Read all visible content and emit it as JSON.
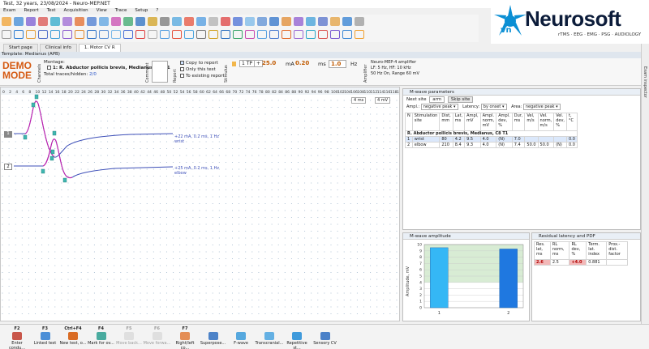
{
  "window": {
    "title": "Test, 32 years, 23/08/2024 - Neuro-MEP.NET"
  },
  "menu": [
    "Exam",
    "Report",
    "Test",
    "Acquisition",
    "View",
    "Trace",
    "Setup",
    "?"
  ],
  "logo": {
    "brand": "Neurosoft",
    "region": "vn",
    "tagline": "rTMS · EEG · EMG · PSG · AUDIOLOGY"
  },
  "tabs": [
    {
      "label": "Start page",
      "active": false
    },
    {
      "label": "Clinical info",
      "active": false
    },
    {
      "label": "1. Motor CV R",
      "active": true
    }
  ],
  "template": {
    "label": "Template: Medianus (APB)"
  },
  "controls": {
    "demo_line1": "DEMO",
    "demo_line2": "MODE",
    "channels_label": "Channels",
    "montage_label": "Montage:",
    "montage_value": "1: R. Abductor pollicis brevis, Medianus, C8 T1",
    "traces_label": "Total traces/hidden:",
    "traces_value": "2/0",
    "comment_label": "Comment",
    "report_label": "Report",
    "copy_to_report": "Copy to report",
    "only_this_test": "Only this test",
    "to_existing_report": "To existing report",
    "stimulus_label": "Stimulus",
    "tp_label": "1 TP",
    "current": "25.0",
    "current_unit": "mA",
    "duration": "0.20",
    "duration_unit": "ms",
    "frequency": "1.0",
    "frequency_unit": "Hz",
    "amplifier_label": "Amplifier",
    "amp_name": "Neuro-MEP-4 amplifier",
    "amp_lf": "LF: 5 Hz, HF: 10 kHz",
    "amp_notch": "50 Hz  On, Range 60 mV"
  },
  "plot": {
    "ruler": [
      "0",
      "2",
      "4",
      "6",
      "8",
      "10",
      "12",
      "14",
      "16",
      "18",
      "20",
      "22",
      "24",
      "26",
      "28",
      "30",
      "32",
      "34",
      "36",
      "38",
      "40",
      "42",
      "44",
      "46",
      "48",
      "50",
      "52",
      "54",
      "56",
      "58",
      "60",
      "62",
      "64",
      "66",
      "68",
      "70",
      "72",
      "74",
      "76",
      "78",
      "80",
      "82",
      "84",
      "86",
      "88",
      "90",
      "92",
      "94",
      "96",
      "98",
      "100",
      "102",
      "104",
      "106",
      "108",
      "110",
      "112",
      "114",
      "116",
      "118",
      "120"
    ],
    "sweep": "4 ms",
    "gain": "4 mV",
    "trace1": {
      "number": "1",
      "param": "+22 mA, 0.2 ms, 1 Hz",
      "site": "wrist"
    },
    "trace2": {
      "number": "2",
      "param": "+25 mA, 0.2 ms, 1 Hz",
      "site": "elbow"
    },
    "colors": {
      "trace": "#3d4fb8",
      "marker": "#c21fae",
      "grid": "#9fb6cc"
    }
  },
  "mwave": {
    "title": "M-wave parameters",
    "next_site_label": "Next site",
    "next_site_value": "arm",
    "skip_site": "Skip site",
    "ampl_label": "Ampl.:",
    "ampl_value": "negative peak",
    "latency_label": "Latency:",
    "latency_value": "by onset",
    "area_label": "Area:",
    "area_value": "negative peak",
    "columns": [
      "N",
      "Stimulation site",
      "Dist, mm",
      "Lat, ms",
      "Ampl, mV",
      "Ampl. norm, mV",
      "Ampl. dev, %",
      "Dur, ms",
      "Vel, m/s",
      "Vel. norm, m/s",
      "Vel. dev, %",
      "t, °C"
    ],
    "group_row": "R. Abductor pollicis brevis, Medianus, C8 T1",
    "rows": [
      [
        "1",
        "wrist",
        "80",
        "4.2",
        "9.5",
        "4.0",
        "(N)",
        "7.0",
        "",
        "",
        "",
        "0.0"
      ],
      [
        "2",
        "elbow",
        "210",
        "8.4",
        "9.3",
        "4.0",
        "(N)",
        "7.4",
        "50.0",
        "50.0",
        "(N)",
        "0.0"
      ]
    ]
  },
  "amplitude_chart": {
    "title": "M-wave amplitude",
    "ylabel": "Amplitude, mV",
    "yticks": [
      "10",
      "9",
      "8",
      "7",
      "6",
      "5",
      "4",
      "3",
      "2",
      "1",
      "0"
    ],
    "xticks": [
      "1",
      "2"
    ]
  },
  "chart_data": {
    "type": "bar",
    "title": "M-wave amplitude",
    "categories": [
      "1",
      "2"
    ],
    "values": [
      9.5,
      9.3
    ],
    "ylabel": "Amplitude, mV",
    "xlabel": "",
    "ylim": [
      0,
      10
    ],
    "normal_band": [
      4,
      10
    ],
    "colors": [
      "#35b7f5",
      "#1f78e0"
    ],
    "grid": true
  },
  "residual": {
    "title": "Residual latency and PDF",
    "columns": [
      "Res. lat, ms",
      "RL norm, ms",
      "RL dev, %",
      "Term. lat. index",
      "Prox.-dist. factor"
    ],
    "row": [
      "2.6",
      "2.5",
      "+4.0",
      "0.881",
      ""
    ],
    "highlight_color": "#f2b8b8"
  },
  "bottom_buttons": [
    {
      "key": "F2",
      "label": "Enter condu...",
      "enabled": true
    },
    {
      "key": "F3",
      "label": "Linked test",
      "enabled": true
    },
    {
      "key": "Ctrl+F4",
      "label": "New test, o...",
      "enabled": true
    },
    {
      "key": "F4",
      "label": "Mark for ov...",
      "enabled": true
    },
    {
      "key": "F5",
      "label": "Move back...",
      "enabled": false
    },
    {
      "key": "F6",
      "label": "Move forwa...",
      "enabled": false
    },
    {
      "key": "F7",
      "label": "Right/left co...",
      "enabled": true
    },
    {
      "key": "",
      "label": "Superpose...",
      "enabled": true
    },
    {
      "key": "",
      "label": "F-wave",
      "enabled": true
    },
    {
      "key": "",
      "label": "Transcranial...",
      "enabled": true
    },
    {
      "key": "",
      "label": "Repetitive st...",
      "enabled": true
    },
    {
      "key": "",
      "label": "Sensory CV",
      "enabled": true
    }
  ],
  "sidebar": {
    "label": "Exam inspector"
  }
}
